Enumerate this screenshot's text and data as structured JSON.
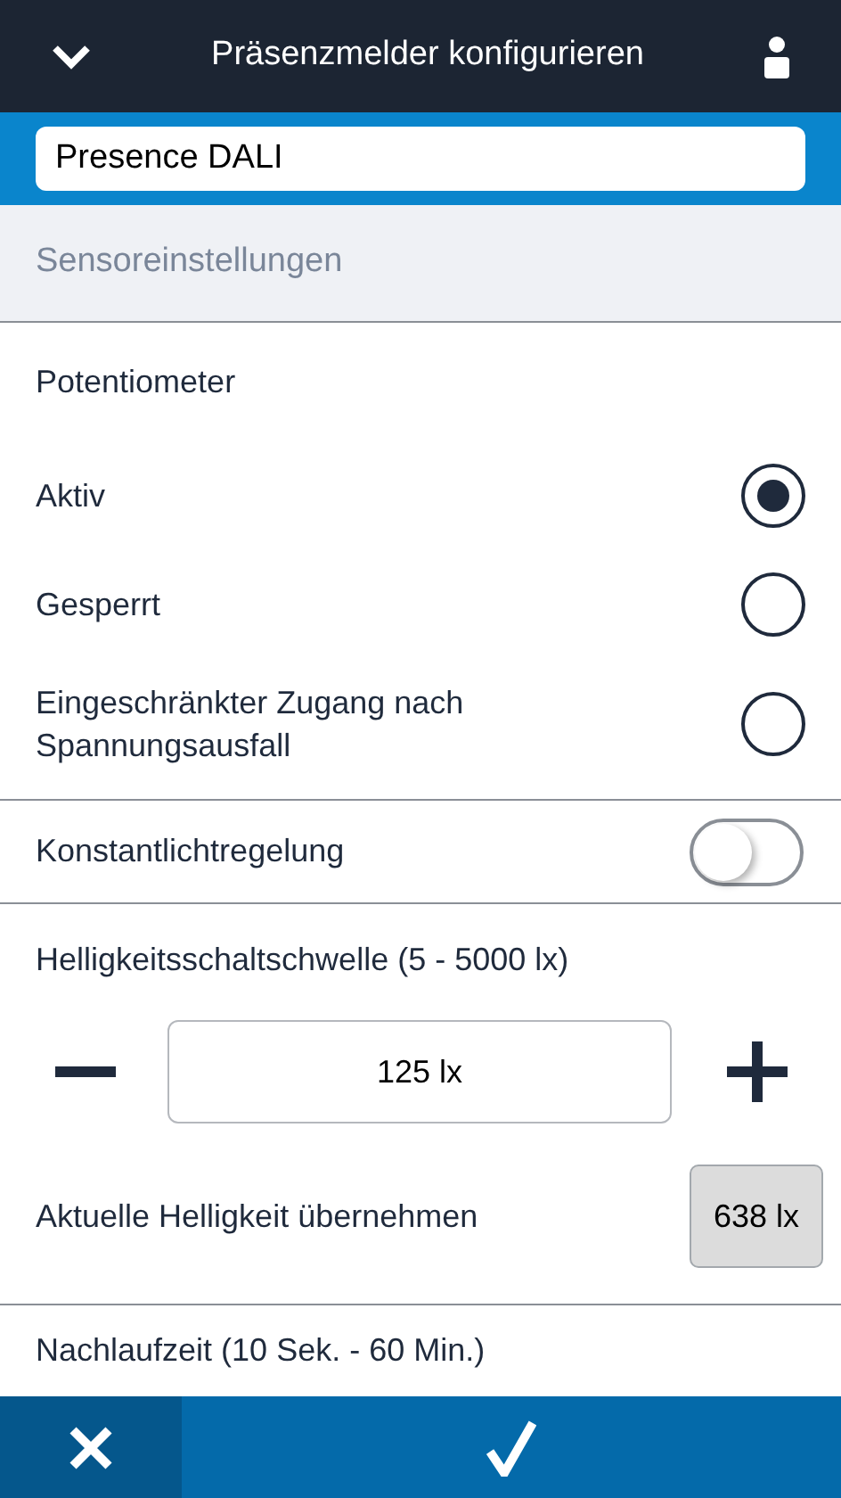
{
  "header": {
    "title": "Präsenzmelder konfigurieren"
  },
  "name_field": {
    "value": "Presence DALI"
  },
  "section": {
    "title": "Sensoreinstellungen"
  },
  "potentiometer": {
    "label": "Potentiometer",
    "options": [
      {
        "label": "Aktiv",
        "selected": true
      },
      {
        "label": "Gesperrt",
        "selected": false
      },
      {
        "label": "Eingeschränkter Zugang nach Spannungsausfall",
        "selected": false
      }
    ]
  },
  "constant_light": {
    "label": "Konstantlichtregelung",
    "on": false
  },
  "threshold": {
    "label": "Helligkeitsschaltschwelle (5 - 5000 lx)",
    "value": "125 lx"
  },
  "current_brightness": {
    "label": "Aktuelle Helligkeit übernehmen",
    "button": "638 lx"
  },
  "follow_up": {
    "label": "Nachlaufzeit (10 Sek. - 60 Min.)"
  }
}
